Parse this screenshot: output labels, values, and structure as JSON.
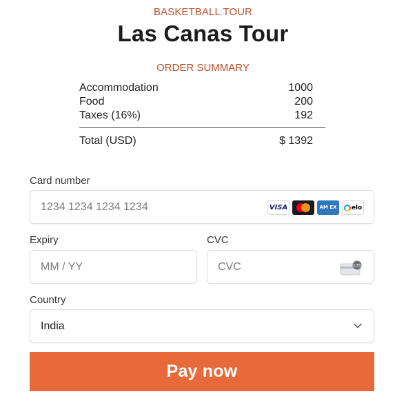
{
  "header": {
    "eyebrow": "BASKETBALL TOUR",
    "title": "Las Canas Tour"
  },
  "summary": {
    "heading": "ORDER SUMMARY",
    "items": [
      {
        "label": "Accommodation",
        "amount": "1000"
      },
      {
        "label": "Food",
        "amount": "200"
      },
      {
        "label": "Taxes (16%)",
        "amount": "192"
      }
    ],
    "total_label": "Total (USD)",
    "total_amount": "$ 1392"
  },
  "form": {
    "card_number_label": "Card number",
    "card_number_placeholder": "1234 1234 1234 1234",
    "card_brands": [
      {
        "name": "visa",
        "text": "VISA"
      },
      {
        "name": "mastercard",
        "text": ""
      },
      {
        "name": "amex",
        "text": "AM EX"
      },
      {
        "name": "elo",
        "text": "elo"
      }
    ],
    "expiry_label": "Expiry",
    "expiry_placeholder": "MM / YY",
    "cvc_label": "CVC",
    "cvc_placeholder": "CVC",
    "cvc_icon_text": "135",
    "country_label": "Country",
    "country_value": "India"
  },
  "actions": {
    "pay_label": "Pay now"
  },
  "colors": {
    "accent": "#e8693a",
    "eyebrow": "#b8502b"
  },
  "icons": {
    "cvc": "card-cvc-icon",
    "country_select": "chevron-down-icon"
  }
}
